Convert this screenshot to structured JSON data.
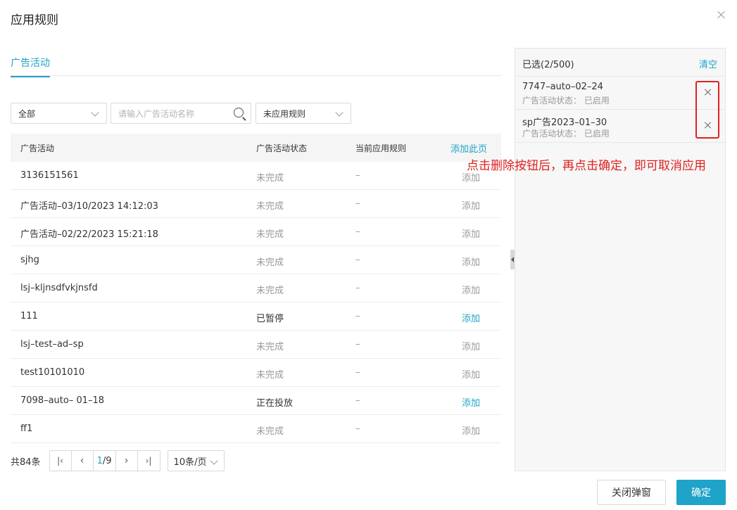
{
  "dialog": {
    "title": "应用规则"
  },
  "tabs": [
    {
      "label": "广告活动",
      "active": true
    }
  ],
  "filters": {
    "scope_value": "全部",
    "search_placeholder": "请输入广告活动名称",
    "rule_value": "未应用规则"
  },
  "table": {
    "headers": {
      "name": "广告活动",
      "status": "广告活动状态",
      "rule": "当前应用规则",
      "add_page": "添加此页"
    },
    "rows": [
      {
        "name": "3136151561",
        "status": "未完成",
        "rule": "–",
        "action": "添加",
        "enabled": false
      },
      {
        "name": "广告活动–03/10/2023 14:12:03",
        "status": "未完成",
        "rule": "–",
        "action": "添加",
        "enabled": false
      },
      {
        "name": "广告活动–02/22/2023 15:21:18",
        "status": "未完成",
        "rule": "–",
        "action": "添加",
        "enabled": false
      },
      {
        "name": "sjhg",
        "status": "未完成",
        "rule": "–",
        "action": "添加",
        "enabled": false
      },
      {
        "name": "lsj–kljnsdfvkjnsfd",
        "status": "未完成",
        "rule": "–",
        "action": "添加",
        "enabled": false
      },
      {
        "name": "111",
        "status": "已暂停",
        "rule": "–",
        "action": "添加",
        "enabled": true
      },
      {
        "name": "lsj–test–ad–sp",
        "status": "未完成",
        "rule": "–",
        "action": "添加",
        "enabled": false
      },
      {
        "name": "test10101010",
        "status": "未完成",
        "rule": "–",
        "action": "添加",
        "enabled": false
      },
      {
        "name": "7098–auto– 01–18",
        "status": "正在投放",
        "rule": "–",
        "action": "添加",
        "enabled": true
      },
      {
        "name": "ff1",
        "status": "未完成",
        "rule": "–",
        "action": "添加",
        "enabled": false
      }
    ]
  },
  "pagination": {
    "total": "共84条",
    "current_page": "1",
    "page_sep": "/",
    "total_pages": "9",
    "page_size": "10条/页",
    "first_glyph": "|‹",
    "prev_glyph": "‹",
    "next_glyph": "›",
    "last_glyph": "›|"
  },
  "selected_panel": {
    "count_label": "已选(2/500)",
    "clear_label": "清空",
    "items": [
      {
        "name": "7747–auto–02–24",
        "status": "广告活动状态：  已启用"
      },
      {
        "name": "sp广告2023–01–30",
        "status": "广告活动状态：  已启用"
      }
    ]
  },
  "annotation": "点击删除按钮后，再点击确定，即可取消应用",
  "footer": {
    "close_label": "关闭弹窗",
    "ok_label": "确定"
  },
  "colors": {
    "accent": "#1fa3c9",
    "annotation_red": "#e02020",
    "muted_text": "#999999"
  }
}
